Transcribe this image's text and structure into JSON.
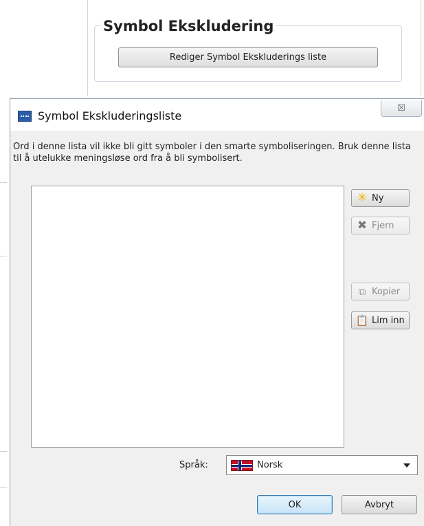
{
  "background": {
    "group_title": "Symbol Ekskludering",
    "edit_button_label": "Rediger Symbol Ekskluderings liste"
  },
  "dialog": {
    "title": "Symbol Ekskluderingsliste",
    "close_icon": "close-icon",
    "close_glyph": "☒",
    "description": "Ord i denne lista vil ikke bli gitt symboler i den smarte symboliseringen. Bruk denne lista til å utelukke meningsløse ord fra å bli symbolisert.",
    "buttons": {
      "new": {
        "label": "Ny",
        "icon": "star-icon",
        "enabled": true
      },
      "remove": {
        "label": "Fjern",
        "icon": "x-icon",
        "enabled": false
      },
      "copy": {
        "label": "Kopier",
        "icon": "copy-icon",
        "enabled": false
      },
      "paste": {
        "label": "Lim inn",
        "icon": "paste-icon",
        "enabled": true
      }
    },
    "language": {
      "label": "Språk:",
      "selected": "Norsk",
      "flag_icon": "norway-flag-icon"
    },
    "ok_label": "OK",
    "cancel_label": "Avbryt"
  },
  "colors": {
    "ok_button": "#c7e4f8",
    "dialog_bg": "#f0f0f0",
    "app_icon": "#2a5ea8"
  }
}
